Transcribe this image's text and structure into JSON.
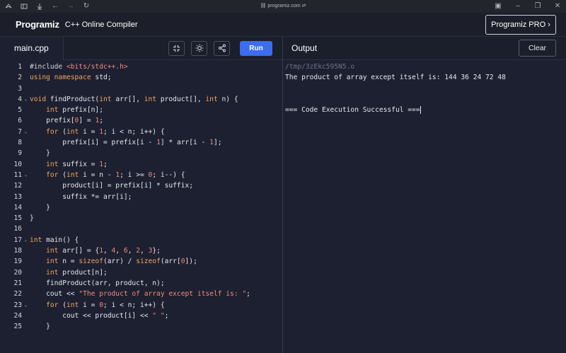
{
  "browser": {
    "url": "programiz.com"
  },
  "site": {
    "logo": "Programiz",
    "title": "C++ Online Compiler",
    "pro_button": "Programiz PRO ›"
  },
  "editor": {
    "file_tab": "main.cpp",
    "run_label": "Run",
    "lines": [
      {
        "n": "1",
        "html": "<span class=\"pp\">#include </span><span class=\"inc\">&lt;bits/stdc++.h&gt;</span>"
      },
      {
        "n": "2",
        "html": "<span class=\"kw\">using namespace </span>std;"
      },
      {
        "n": "3",
        "html": ""
      },
      {
        "n": "4",
        "html": "<span class=\"kw\">void </span>findProduct(<span class=\"kw\">int </span>arr[], <span class=\"kw\">int </span>product[], <span class=\"kw\">int </span>n) {",
        "fold": true
      },
      {
        "n": "5",
        "html": "    <span class=\"kw\">int </span>prefix[n];"
      },
      {
        "n": "6",
        "html": "    prefix[<span class=\"num\">0</span>] = <span class=\"num\">1</span>;"
      },
      {
        "n": "7",
        "html": "    <span class=\"kw\">for </span>(<span class=\"kw\">int </span>i = <span class=\"num\">1</span>; i &lt; n; i++) {",
        "fold": true
      },
      {
        "n": "8",
        "html": "        prefix[i] = prefix[i - <span class=\"num\">1</span>] * arr[i - <span class=\"num\">1</span>];"
      },
      {
        "n": "9",
        "html": "    }"
      },
      {
        "n": "10",
        "html": "    <span class=\"kw\">int </span>suffix = <span class=\"num\">1</span>;"
      },
      {
        "n": "11",
        "html": "    <span class=\"kw\">for </span>(<span class=\"kw\">int </span>i = n - <span class=\"num\">1</span>; i &gt;= <span class=\"num\">0</span>; i--) {",
        "fold": true
      },
      {
        "n": "12",
        "html": "        product[i] = prefix[i] * suffix;"
      },
      {
        "n": "13",
        "html": "        suffix *= arr[i];"
      },
      {
        "n": "14",
        "html": "    }"
      },
      {
        "n": "15",
        "html": "}"
      },
      {
        "n": "16",
        "html": ""
      },
      {
        "n": "17",
        "html": "<span class=\"kw\">int </span>main() {",
        "fold": true
      },
      {
        "n": "18",
        "html": "    <span class=\"kw\">int </span>arr[] = {<span class=\"num\">1</span>, <span class=\"num\">4</span>, <span class=\"num\">6</span>, <span class=\"num\">2</span>, <span class=\"num\">3</span>};"
      },
      {
        "n": "19",
        "html": "    <span class=\"kw\">int </span>n = <span class=\"kw\">sizeof</span>(arr) / <span class=\"kw\">sizeof</span>(arr[<span class=\"num\">0</span>]);"
      },
      {
        "n": "20",
        "html": "    <span class=\"kw\">int </span>product[n];"
      },
      {
        "n": "21",
        "html": "    findProduct(arr, product, n);"
      },
      {
        "n": "22",
        "html": "    cout &lt;&lt; <span class=\"str\">\"The product of array except itself is: \"</span>;"
      },
      {
        "n": "23",
        "html": "    <span class=\"kw\">for </span>(<span class=\"kw\">int </span>i = <span class=\"num\">0</span>; i &lt; n; i++) {",
        "fold": true
      },
      {
        "n": "24",
        "html": "        cout &lt;&lt; product[i] &lt;&lt; <span class=\"str\">\" \"</span>;"
      },
      {
        "n": "25",
        "html": "    }"
      }
    ]
  },
  "output": {
    "title": "Output",
    "clear_label": "Clear",
    "tmp_path": "/tmp/3zEkc595N5.o",
    "result_line": "The product of array except itself is: 144 36 24 72 48",
    "status_line": "=== Code Execution Successful ==="
  }
}
